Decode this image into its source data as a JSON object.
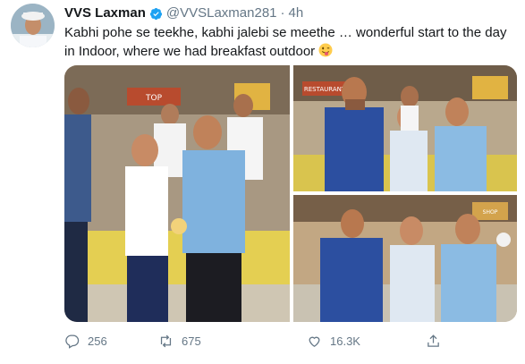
{
  "tweet": {
    "author_name": "VVS Laxman",
    "handle": "@VVSLaxman281",
    "separator": "·",
    "time": "4h",
    "text": "Kabhi pohe se teekhe, kabhi jalebi se meethe … wonderful start to the day in Indoor, where we had breakfast outdoor",
    "emoji": "tongue-out-face-icon"
  },
  "media": {
    "photo_1": {
      "sign_text": "TOP"
    },
    "photo_2": {
      "sign_text": "RESTAURANT"
    },
    "photo_3": {
      "sign_text": "SHOP"
    }
  },
  "actions": {
    "reply_count": "256",
    "retweet_count": "675",
    "like_count": "16.3K"
  },
  "colors": {
    "text": "#14171a",
    "secondary": "#657786",
    "verified": "#1da1f2"
  }
}
